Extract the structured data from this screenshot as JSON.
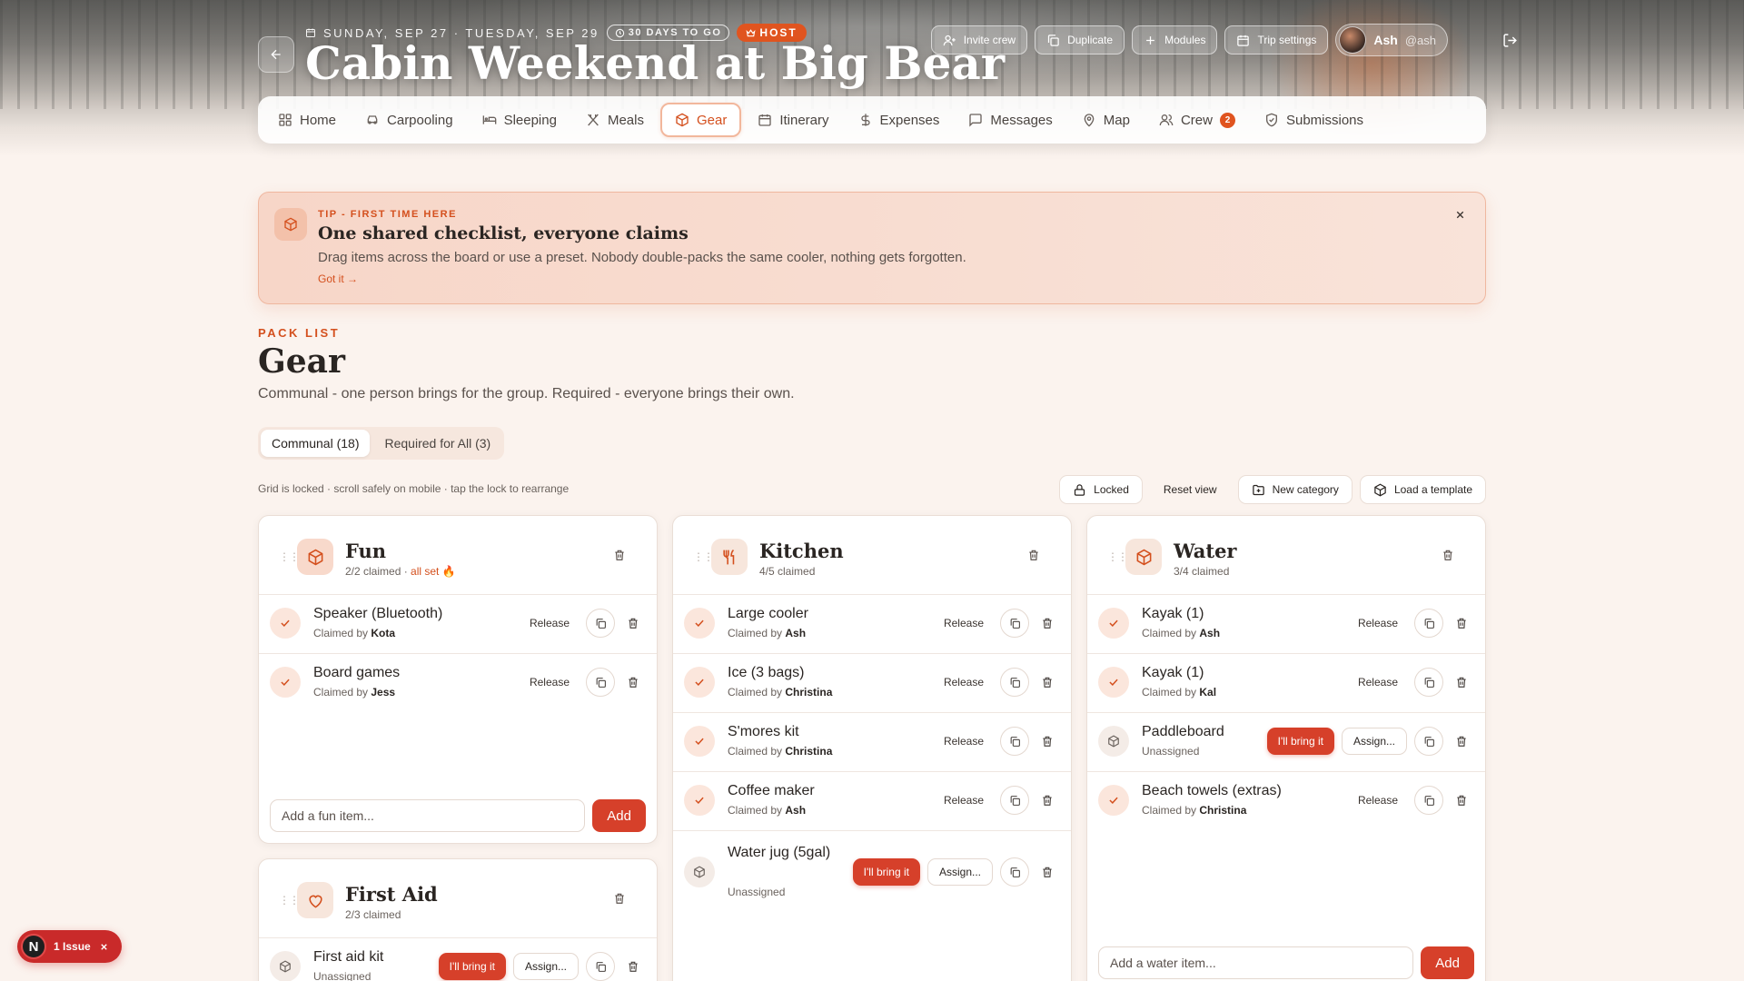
{
  "header": {
    "dates": "SUNDAY, SEP 27 · TUESDAY, SEP 29",
    "countdown": "30 DAYS TO GO",
    "role": "HOST",
    "title": "Cabin Weekend at Big Bear",
    "actions": [
      "Invite crew",
      "Duplicate",
      "Modules",
      "Trip settings"
    ],
    "user": {
      "name": "Ash",
      "handle": "@ash"
    }
  },
  "nav": {
    "items": [
      {
        "label": "Home",
        "icon": "home-icon"
      },
      {
        "label": "Carpooling",
        "icon": "car-icon"
      },
      {
        "label": "Sleeping",
        "icon": "bed-icon"
      },
      {
        "label": "Meals",
        "icon": "utensils-icon"
      },
      {
        "label": "Gear",
        "icon": "box-icon",
        "active": true
      },
      {
        "label": "Itinerary",
        "icon": "calendar-icon"
      },
      {
        "label": "Expenses",
        "icon": "dollar-icon"
      },
      {
        "label": "Messages",
        "icon": "message-icon"
      },
      {
        "label": "Map",
        "icon": "map-pin-icon"
      },
      {
        "label": "Crew",
        "icon": "users-icon",
        "badge": "2"
      },
      {
        "label": "Submissions",
        "icon": "shield-check-icon"
      }
    ]
  },
  "tip": {
    "kicker": "TIP - FIRST TIME HERE",
    "title": "One shared checklist, everyone claims",
    "body": "Drag items across the board or use a preset. Nobody double-packs the same cooler, nothing gets forgotten.",
    "link": "Got it →"
  },
  "page": {
    "kicker": "PACK LIST",
    "title": "Gear",
    "subtitle": "Communal - one person brings for the group. Required - everyone brings their own.",
    "tabs": [
      "Communal (18)",
      "Required for All (3)"
    ],
    "grid_note": "Grid is locked · scroll safely on mobile · tap the lock to rearrange",
    "tools": [
      "Locked",
      "Reset view",
      "New category",
      "Load a template"
    ]
  },
  "labels": {
    "release": "Release",
    "bring": "I'll bring it",
    "assign": "Assign...",
    "claimed_by": "Claimed by",
    "unassigned": "Unassigned",
    "add": "Add"
  },
  "categories": {
    "fun": {
      "name": "Fun",
      "count": "2/2 claimed",
      "status": "all set 🔥",
      "items": [
        {
          "name": "Speaker (Bluetooth)",
          "by": "Kota"
        },
        {
          "name": "Board games",
          "by": "Jess"
        }
      ],
      "placeholder": "Add a fun item..."
    },
    "kitchen": {
      "name": "Kitchen",
      "count": "4/5 claimed",
      "items": [
        {
          "name": "Large cooler",
          "by": "Ash"
        },
        {
          "name": "Ice (3 bags)",
          "by": "Christina"
        },
        {
          "name": "S'mores kit",
          "by": "Christina"
        },
        {
          "name": "Coffee maker",
          "by": "Ash"
        },
        {
          "name": "Water jug (5gal)"
        }
      ]
    },
    "water": {
      "name": "Water",
      "count": "3/4 claimed",
      "items": [
        {
          "name": "Kayak (1)",
          "by": "Ash"
        },
        {
          "name": "Kayak (1)",
          "by": "Kal"
        },
        {
          "name": "Paddleboard"
        },
        {
          "name": "Beach towels (extras)",
          "by": "Christina"
        }
      ],
      "placeholder": "Add a water item..."
    },
    "first_aid": {
      "name": "First Aid",
      "count": "2/3 claimed",
      "items": [
        {
          "name": "First aid kit"
        }
      ]
    }
  },
  "issue": {
    "label": "1 Issue",
    "logo": "N"
  }
}
